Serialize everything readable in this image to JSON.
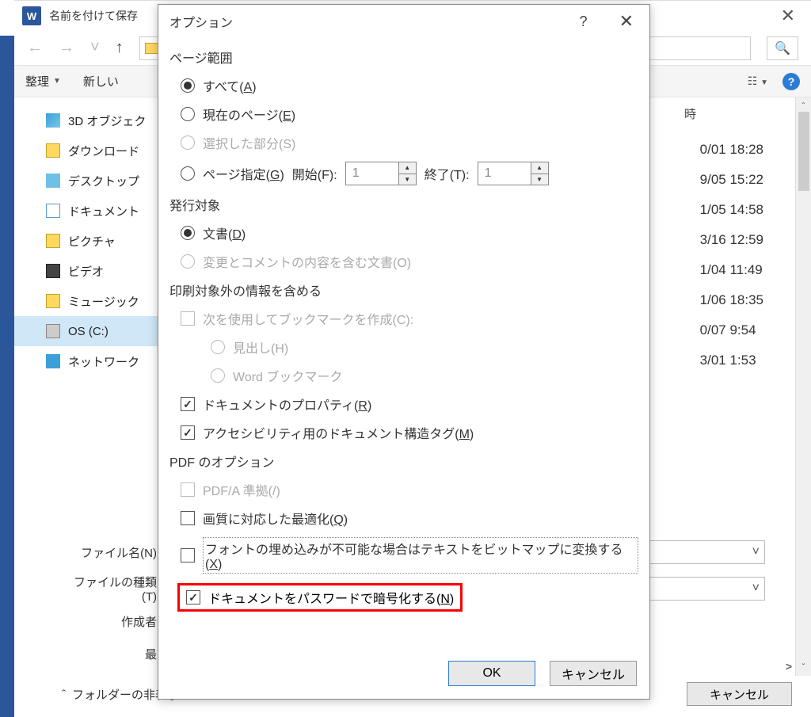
{
  "saveas": {
    "title": "名前を付けて保存",
    "toolbar": {
      "organize": "整理",
      "new": "新しい"
    },
    "tree": {
      "items": [
        {
          "label": "3D オブジェク"
        },
        {
          "label": "ダウンロード"
        },
        {
          "label": "デスクトップ"
        },
        {
          "label": "ドキュメント"
        },
        {
          "label": "ピクチャ"
        },
        {
          "label": "ビデオ"
        },
        {
          "label": "ミュージック"
        },
        {
          "label": "OS (C:)"
        },
        {
          "label": "ネットワーク"
        }
      ]
    },
    "col_date_header": "時",
    "dates": [
      "0/01 18:28",
      "9/05 15:22",
      "1/05 14:58",
      "3/16 12:59",
      "1/04 11:49",
      "1/06 18:35",
      "0/07 9:54",
      "3/01 1:53"
    ],
    "filename_label": "ファイル名(N)",
    "filetype_label": "ファイルの種類(T)",
    "author_label": "作成者",
    "recent_label": "最",
    "fold_toggle": "フォルダーの非表示",
    "cancel_btn": "キャンセル"
  },
  "options": {
    "title": "オプション",
    "section_page_range": "ページ範囲",
    "radio_all": {
      "pre": "すべて(",
      "acc": "A",
      "post": ")"
    },
    "radio_current": {
      "pre": "現在のページ(",
      "acc": "E",
      "post": ")"
    },
    "radio_selection": "選択した部分(S)",
    "radio_pages": {
      "pre": "ページ指定(",
      "acc": "G",
      "post": ")"
    },
    "range_from": "開始(F):",
    "range_to": "終了(T):",
    "range_from_val": "1",
    "range_to_val": "1",
    "section_publish": "発行対象",
    "radio_doc": {
      "pre": "文書(",
      "acc": "D",
      "post": ")"
    },
    "radio_doc_markup": "変更とコメントの内容を含む文書(O)",
    "section_include": "印刷対象外の情報を含める",
    "check_bookmarks": "次を使用してブックマークを作成(C):",
    "radio_headings": "見出し(H)",
    "radio_word_bm": "Word ブックマーク",
    "check_properties": {
      "pre": "ドキュメントのプロパティ(",
      "acc": "R",
      "post": ")"
    },
    "check_a11y": {
      "pre": "アクセシビリティ用のドキュメント構造タグ(",
      "acc": "M",
      "post": ")"
    },
    "section_pdf": "PDF のオプション",
    "check_pdfa": "PDF/A 準拠(/)",
    "check_quality": {
      "pre": "画質に対応した最適化(",
      "acc": "Q",
      "post": ")"
    },
    "check_bitmap": {
      "pre": "フォントの埋め込みが不可能な場合はテキストをビットマップに変換する(",
      "acc": "X",
      "post": ")"
    },
    "check_encrypt": {
      "pre": "ドキュメントをパスワードで暗号化する(",
      "acc": "N",
      "post": ")"
    },
    "ok_btn": "OK",
    "cancel_btn": "キャンセル"
  }
}
